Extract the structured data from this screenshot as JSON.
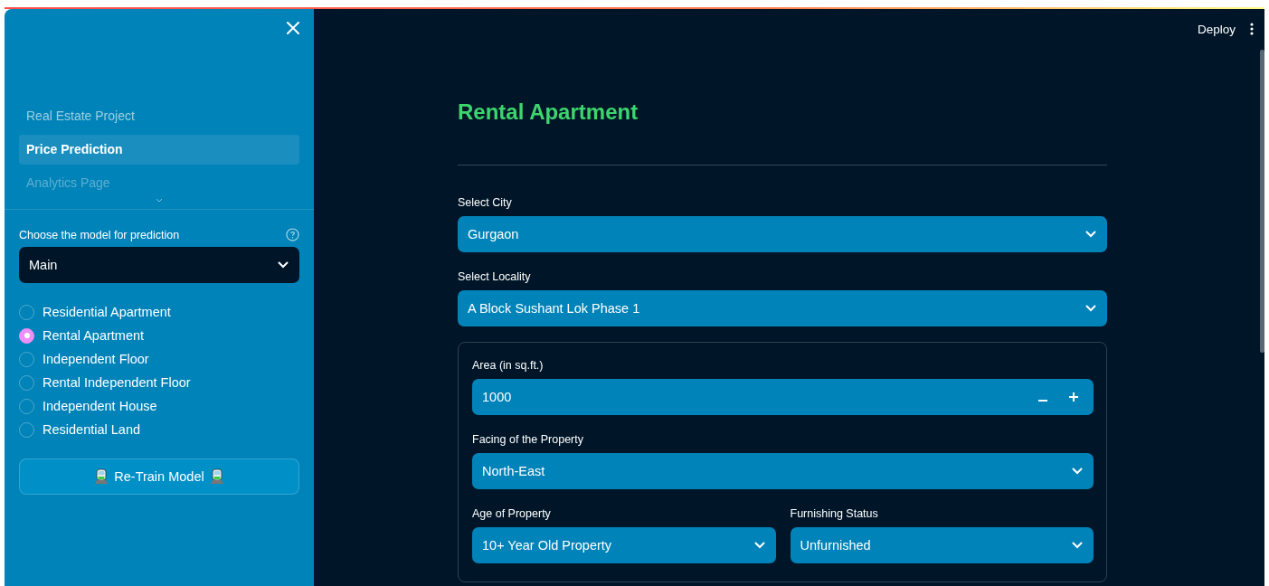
{
  "header": {
    "deploy": "Deploy"
  },
  "sidebar": {
    "nav": [
      {
        "label": "Real Estate Project",
        "selected": false
      },
      {
        "label": "Price Prediction",
        "selected": true
      },
      {
        "label": "Analytics Page",
        "selected": false
      }
    ],
    "model_select": {
      "label": "Choose the model for prediction",
      "value": "Main"
    },
    "property_types": [
      {
        "label": "Residential Apartment",
        "selected": false
      },
      {
        "label": "Rental Apartment",
        "selected": true
      },
      {
        "label": "Independent Floor",
        "selected": false
      },
      {
        "label": "Rental Independent Floor",
        "selected": false
      },
      {
        "label": "Independent House",
        "selected": false
      },
      {
        "label": "Residential Land",
        "selected": false
      }
    ],
    "retrain_button": "Re-Train Model"
  },
  "main": {
    "title": "Rental Apartment",
    "city": {
      "label": "Select City",
      "value": "Gurgaon"
    },
    "locality": {
      "label": "Select Locality",
      "value": "A Block Sushant Lok Phase 1"
    },
    "form": {
      "area": {
        "label": "Area (in sq.ft.)",
        "value": "1000"
      },
      "facing": {
        "label": "Facing of the Property",
        "value": "North-East"
      },
      "age": {
        "label": "Age of Property",
        "value": "10+ Year Old Property"
      },
      "furnishing": {
        "label": "Furnishing Status",
        "value": "Unfurnished"
      }
    }
  }
}
